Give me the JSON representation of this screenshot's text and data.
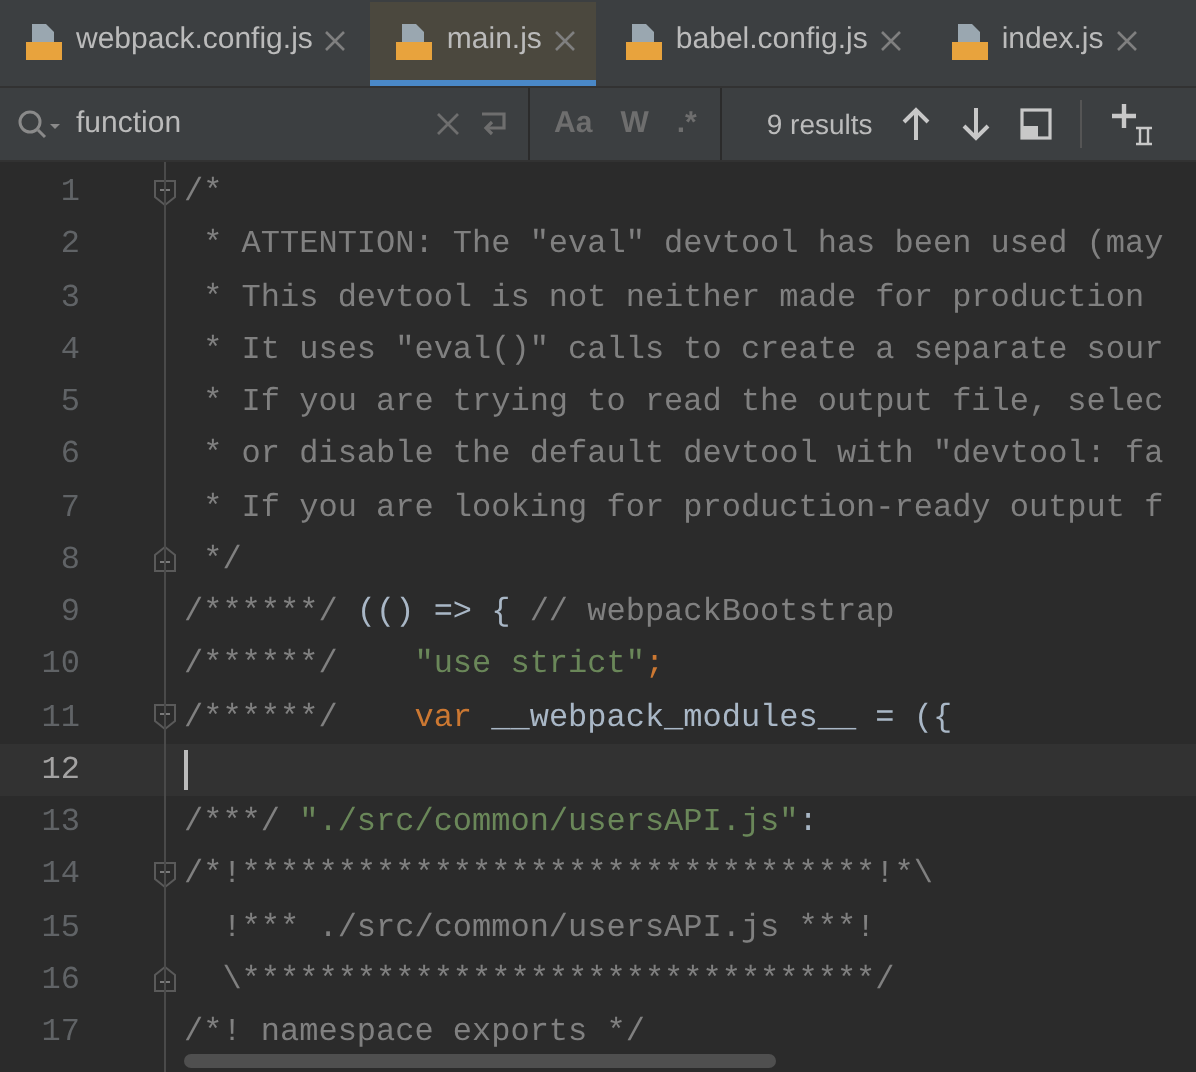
{
  "tabs": [
    {
      "label": "webpack.config.js",
      "selected": false
    },
    {
      "label": "main.js",
      "selected": true
    },
    {
      "label": "babel.config.js",
      "selected": false
    },
    {
      "label": "index.js",
      "selected": false
    }
  ],
  "search": {
    "value": "function",
    "options": [
      "Aa",
      "W",
      ".*"
    ],
    "results": "9 results"
  },
  "lines": [
    {
      "number": "1",
      "current": false,
      "fold_open": true,
      "tokens": [
        {
          "kind": "comment",
          "text": "/*"
        }
      ]
    },
    {
      "number": "2",
      "current": false,
      "tokens": [
        {
          "kind": "comment",
          "text": " * ATTENTION: The \"eval\" devtool has been used (may"
        }
      ]
    },
    {
      "number": "3",
      "current": false,
      "tokens": [
        {
          "kind": "comment",
          "text": " * This devtool is not neither made for production"
        }
      ]
    },
    {
      "number": "4",
      "current": false,
      "tokens": [
        {
          "kind": "comment",
          "text": " * It uses \"eval()\" calls to create a separate sour"
        }
      ]
    },
    {
      "number": "5",
      "current": false,
      "tokens": [
        {
          "kind": "comment",
          "text": " * If you are trying to read the output file, selec"
        }
      ]
    },
    {
      "number": "6",
      "current": false,
      "tokens": [
        {
          "kind": "comment",
          "text": " * or disable the default devtool with \"devtool: fa"
        }
      ]
    },
    {
      "number": "7",
      "current": false,
      "tokens": [
        {
          "kind": "comment",
          "text": " * If you are looking for production-ready output f"
        }
      ]
    },
    {
      "number": "8",
      "current": false,
      "fold_close": true,
      "tokens": [
        {
          "kind": "comment",
          "text": " */"
        }
      ]
    },
    {
      "number": "9",
      "current": false,
      "tokens": [
        {
          "kind": "comment",
          "text": "/******/"
        },
        {
          "kind": "plain",
          "text": " (() => { "
        },
        {
          "kind": "comment",
          "text": "// webpackBootstrap"
        }
      ]
    },
    {
      "number": "10",
      "current": false,
      "tokens": [
        {
          "kind": "comment",
          "text": "/******/"
        },
        {
          "kind": "string",
          "text": "    \"use strict\""
        },
        {
          "kind": "keyword",
          "text": ";"
        }
      ]
    },
    {
      "number": "11",
      "current": false,
      "fold_open": true,
      "tokens": [
        {
          "kind": "comment",
          "text": "/******/"
        },
        {
          "kind": "keyword",
          "text": "    var"
        },
        {
          "kind": "plain",
          "text": " __webpack_modules__ = ({"
        }
      ]
    },
    {
      "number": "12",
      "current": true
    },
    {
      "number": "13",
      "current": false,
      "tokens": [
        {
          "kind": "comment",
          "text": "/***/"
        },
        {
          "kind": "string",
          "text": " \"./src/common/usersAPI.js\""
        },
        {
          "kind": "plain",
          "text": ":"
        }
      ]
    },
    {
      "number": "14",
      "current": false,
      "fold_open": true,
      "tokens": [
        {
          "kind": "comment",
          "text": "/*!*********************************!*\\"
        }
      ]
    },
    {
      "number": "15",
      "current": false,
      "tokens": [
        {
          "kind": "comment",
          "text": "  !*** ./src/common/usersAPI.js ***!"
        }
      ]
    },
    {
      "number": "16",
      "current": false,
      "fold_close": true,
      "tokens": [
        {
          "kind": "comment",
          "text": "  \\*********************************/"
        }
      ]
    },
    {
      "number": "17",
      "current": false,
      "tokens": [
        {
          "kind": "comment",
          "text": "/*! namespace exports */"
        }
      ]
    }
  ]
}
